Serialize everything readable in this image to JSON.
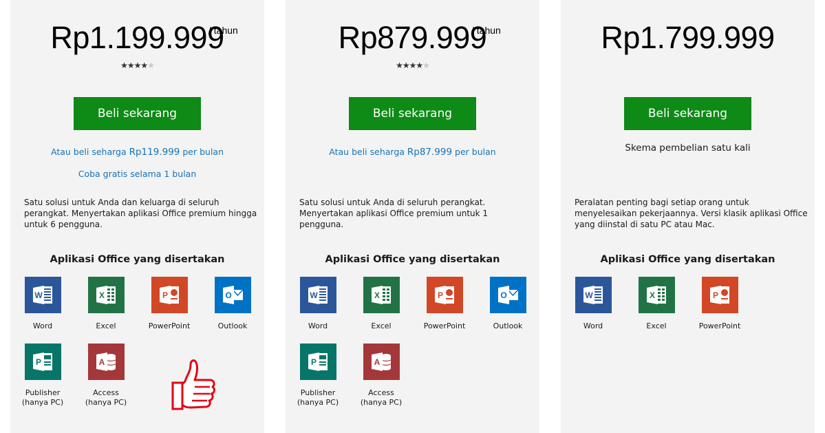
{
  "plans": [
    {
      "price": "Rp1.199.999",
      "per": "/ tahun",
      "buy_label": "Beli sekarang",
      "monthly_prefix": "Atau beli seharga ",
      "monthly_amount": "Rp119.999",
      "monthly_suffix": " per bulan",
      "trial": "Coba gratis selama 1 bulan",
      "desc": "Satu solusi untuk Anda dan keluarga di seluruh perangkat. Menyertakan aplikasi Office premium hingga untuk 6 pengguna.",
      "apps_title": "Aplikasi Office yang disertakan",
      "rating": 4
    },
    {
      "price": "Rp879.999",
      "per": "/ tahun",
      "buy_label": "Beli sekarang",
      "monthly_prefix": "Atau beli seharga ",
      "monthly_amount": "Rp87.999",
      "monthly_suffix": " per bulan",
      "desc": "Satu solusi untuk Anda di seluruh perangkat. Menyertakan aplikasi Office premium untuk 1 pengguna.",
      "apps_title": "Aplikasi Office yang disertakan",
      "rating": 4
    },
    {
      "price": "Rp1.799.999",
      "buy_label": "Beli sekarang",
      "onetime": "Skema pembelian satu kali",
      "desc": "Peralatan penting bagi setiap orang untuk menyelesaikan pekerjaannya. Versi klasik aplikasi Office yang diinstal di satu PC atau Mac.",
      "apps_title": "Aplikasi Office yang disertakan"
    }
  ],
  "apps": {
    "word": "Word",
    "excel": "Excel",
    "powerpoint": "PowerPoint",
    "outlook": "Outlook",
    "publisher_1": "Publisher",
    "publisher_2": "(hanya PC)",
    "access_1": "Access",
    "access_2": "(hanya PC)"
  },
  "colors": {
    "buy_button": "#0e8a16",
    "link": "#1473b8",
    "word": "#2b579a",
    "excel": "#217346",
    "powerpoint": "#d24726",
    "outlook": "#0072c6",
    "publisher": "#077568",
    "access": "#a4373a",
    "thumb": "#e30613"
  },
  "icons": [
    "star-icon",
    "word-icon",
    "excel-icon",
    "powerpoint-icon",
    "outlook-icon",
    "publisher-icon",
    "access-icon",
    "thumbs-up-icon"
  ]
}
